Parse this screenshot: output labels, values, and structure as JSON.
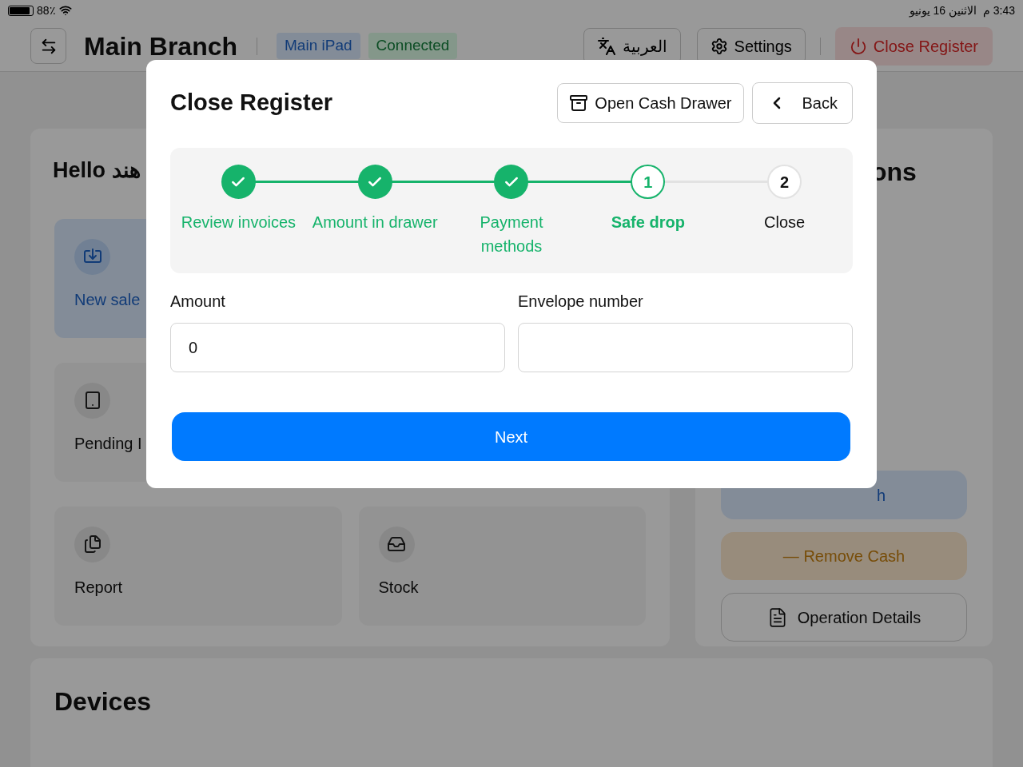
{
  "status_bar": {
    "battery": "88٪",
    "date": "الاثنين 16 يونيو",
    "time": "3:43 م"
  },
  "header": {
    "title": "Main Branch",
    "badges": [
      {
        "label": "Main iPad",
        "kind": "device"
      },
      {
        "label": "Connected",
        "kind": "status"
      }
    ],
    "language": "العربية",
    "settings": "Settings",
    "close_register": "Close Register"
  },
  "greeting": "Hello هند",
  "tiles": [
    {
      "label": "New sale",
      "kind": "primary"
    },
    {
      "label": "Pending I",
      "kind": "plain"
    },
    {
      "label": "Report",
      "kind": "plain"
    },
    {
      "label": "Stock",
      "kind": "plain"
    }
  ],
  "actions_title": "ons",
  "actions": [
    {
      "label": "h",
      "kind": "add"
    },
    {
      "label": "— Remove Cash",
      "kind": "remove"
    },
    {
      "label": "Operation Details",
      "kind": "details"
    }
  ],
  "devices_title": "Devices",
  "dialog": {
    "title": "Close Register",
    "open_drawer": "Open Cash Drawer",
    "back": "Back",
    "steps": [
      {
        "label": "Review invoices",
        "done": true,
        "selected": false
      },
      {
        "label": "Amount in drawer",
        "done": true,
        "selected": false
      },
      {
        "label": "Payment methods",
        "done": true,
        "selected": false
      },
      {
        "label": "Safe drop",
        "done": false,
        "selected": true,
        "number": "1"
      },
      {
        "label": "Close",
        "done": false,
        "selected": false,
        "number": "2"
      }
    ],
    "fields": [
      {
        "label": "Amount",
        "value": "0"
      },
      {
        "label": "Envelope number"
      }
    ],
    "next": "Next"
  }
}
